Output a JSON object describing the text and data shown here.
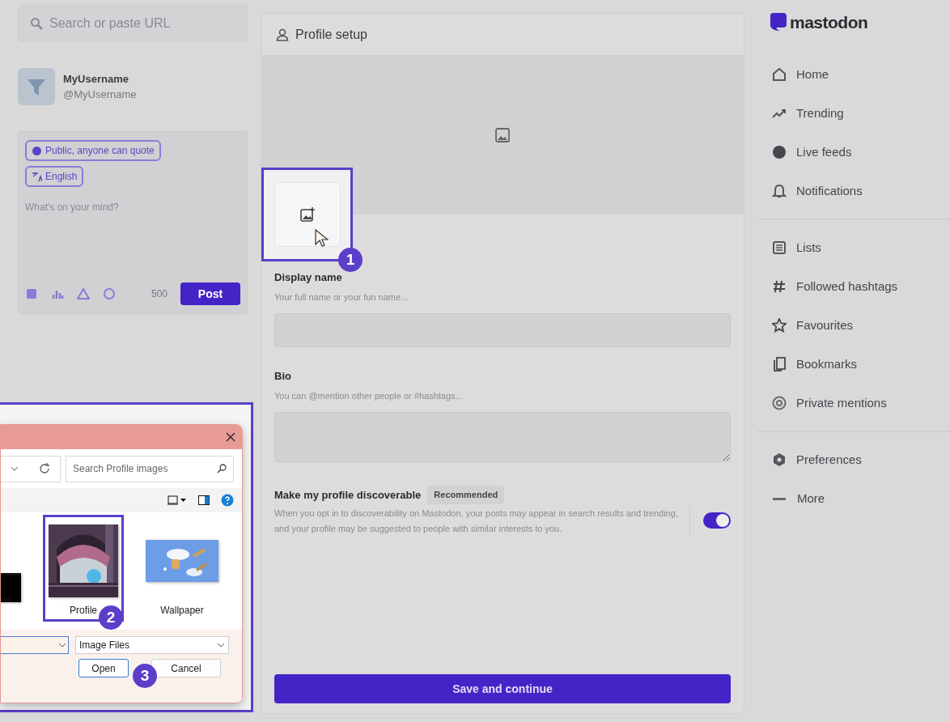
{
  "search": {
    "placeholder": "Search or paste URL"
  },
  "account": {
    "name": "MyUsername",
    "handle": "@MyUsername"
  },
  "composer": {
    "visibility": "Public, anyone can quote",
    "language": "English",
    "placeholder": "What's on your mind?",
    "char_count": "500",
    "post_button": "Post"
  },
  "profile_setup": {
    "title": "Profile setup",
    "display_name": {
      "label": "Display name",
      "placeholder": "Your full name or your fun name..."
    },
    "bio": {
      "label": "Bio",
      "placeholder": "You can @mention other people or #hashtags..."
    },
    "discoverable": {
      "label": "Make my profile discoverable",
      "badge": "Recommended",
      "description": "When you opt in to discoverability on Mastodon, your posts may appear in search results and trending, and your profile may be suggested to people with similar interests to you.",
      "on": true
    },
    "save_button": "Save and continue"
  },
  "nav": {
    "logo": "mastodon",
    "groups": [
      {
        "items": [
          "Home",
          "Trending",
          "Live feeds",
          "Notifications"
        ]
      },
      {
        "items": [
          "Lists",
          "Followed hashtags",
          "Favourites",
          "Bookmarks",
          "Private mentions"
        ]
      },
      {
        "items": [
          "Preferences",
          "More"
        ]
      }
    ]
  },
  "file_dialog": {
    "search_placeholder": "Search Profile images",
    "files": [
      {
        "kind": "dark",
        "selected": false
      },
      {
        "kind": "scene",
        "label": "Profile",
        "selected": true
      },
      {
        "kind": "sky",
        "label": "Wallpaper",
        "selected": false
      }
    ],
    "file_type": "Image Files",
    "open_button": "Open",
    "cancel_button": "Cancel"
  },
  "steps": [
    "1",
    "2",
    "3"
  ]
}
